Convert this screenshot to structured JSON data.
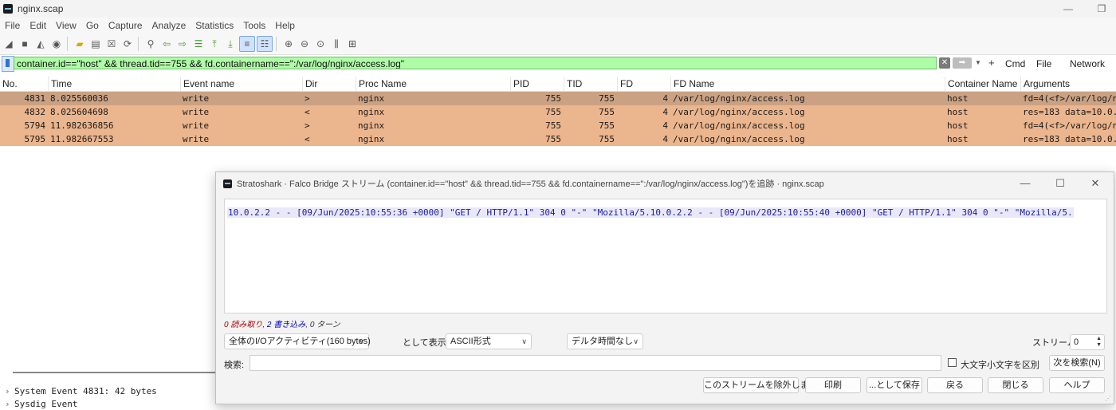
{
  "window": {
    "title": "nginx.scap",
    "restore_glyph": "❐",
    "min_glyph": "—"
  },
  "menu": [
    "File",
    "Edit",
    "View",
    "Go",
    "Capture",
    "Analyze",
    "Statistics",
    "Tools",
    "Help"
  ],
  "filter": {
    "value": "container.id==\"host\" && thread.tid==755 && fd.containername==\":/var/log/nginx/access.log\"",
    "plus": "+",
    "buttons": [
      "Cmd",
      "File",
      "Network"
    ]
  },
  "columns": [
    "No.",
    "Time",
    "Event name",
    "Dir",
    "Proc Name",
    "PID",
    "TID",
    "FD",
    "FD Name",
    "Container Name",
    "Arguments"
  ],
  "rows": [
    {
      "no": "4831",
      "time": "8.025560036",
      "event": "write",
      "dir": ">",
      "proc": "nginx",
      "pid": "755",
      "tid": "755",
      "fd": "4",
      "fdname": "/var/log/nginx/access.log",
      "container": "host",
      "args": "fd=4(<f>/var/log/ng"
    },
    {
      "no": "4832",
      "time": "8.025604698",
      "event": "write",
      "dir": "<",
      "proc": "nginx",
      "pid": "755",
      "tid": "755",
      "fd": "4",
      "fdname": "/var/log/nginx/access.log",
      "container": "host",
      "args": "res=183 data=10.0.2"
    },
    {
      "no": "5794",
      "time": "11.982636856",
      "event": "write",
      "dir": ">",
      "proc": "nginx",
      "pid": "755",
      "tid": "755",
      "fd": "4",
      "fdname": "/var/log/nginx/access.log",
      "container": "host",
      "args": "fd=4(<f>/var/log/ng"
    },
    {
      "no": "5795",
      "time": "11.982667553",
      "event": "write",
      "dir": "<",
      "proc": "nginx",
      "pid": "755",
      "tid": "755",
      "fd": "4",
      "fdname": "/var/log/nginx/access.log",
      "container": "host",
      "args": "res=183 data=10.0.2"
    }
  ],
  "details": [
    "System Event 4831: 42 bytes",
    "Sysdig Event"
  ],
  "dialog": {
    "title": "Stratoshark · Falco Bridge ストリーム (container.id==\"host\" && thread.tid==755 && fd.containername==\":/var/log/nginx/access.log\")を追跡 · nginx.scap",
    "stream_text": "10.0.2.2 - - [09/Jun/2025:10:55:36 +0000] \"GET / HTTP/1.1\" 304 0 \"-\" \"Mozilla/5.10.0.2.2 - - [09/Jun/2025:10:55:40 +0000] \"GET / HTTP/1.1\" 304 0 \"-\" \"Mozilla/5.",
    "stats": {
      "reads": "0 読み取り",
      "sep1": ", ",
      "writes": "2 書き込み",
      "sep2": ", ",
      "turns": "0 ターン"
    },
    "activity_combo": "全体のI/Oアクティビティ(160 bytes)",
    "show_as_label": "として表示",
    "format_combo": "ASCII形式",
    "delta_combo": "デルタ時間なし",
    "stream_label": "ストリーム",
    "stream_value": "0",
    "search_label": "検索:",
    "case_label": "大文字小文字を区別",
    "find_next": "次を検索(N)",
    "buttons": [
      "このストリームを除外します",
      "印刷",
      "...として保存",
      "戻る",
      "閉じる",
      "ヘルプ"
    ]
  }
}
